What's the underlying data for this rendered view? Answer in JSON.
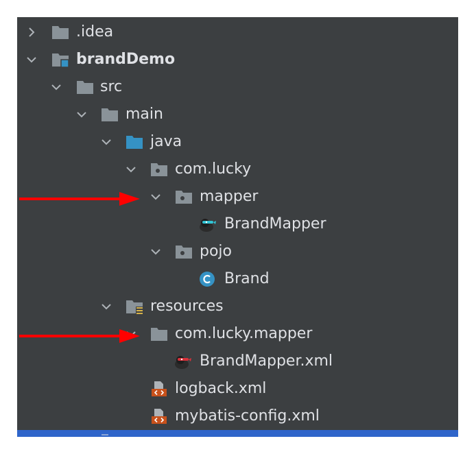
{
  "tree": {
    "rows": [
      {
        "label": "idea_folder",
        "text": ".idea"
      },
      {
        "label": "brandDemo",
        "text": "brandDemo"
      },
      {
        "label": "src",
        "text": "src"
      },
      {
        "label": "main",
        "text": "main"
      },
      {
        "label": "java",
        "text": "java"
      },
      {
        "label": "com_lucky",
        "text": "com.lucky"
      },
      {
        "label": "mapper",
        "text": "mapper"
      },
      {
        "label": "BrandMapper",
        "text": "BrandMapper"
      },
      {
        "label": "pojo",
        "text": "pojo"
      },
      {
        "label": "Brand",
        "text": "Brand"
      },
      {
        "label": "resources",
        "text": "resources"
      },
      {
        "label": "com_lucky_mapper",
        "text": "com.lucky.mapper"
      },
      {
        "label": "BrandMapper_xml",
        "text": "BrandMapper.xml"
      },
      {
        "label": "logback_xml",
        "text": "logback.xml"
      },
      {
        "label": "mybatis_config_xml",
        "text": "mybatis-config.xml"
      }
    ]
  },
  "colors": {
    "panel_bg": "#3c3f41",
    "text": "#dfe1e5",
    "folder_gray": "#8a9399",
    "source_folder_blue": "#3592c4",
    "module_marker": "#3592c4",
    "class_icon": "#3592c4",
    "xml_icon": "#c8511b",
    "annotation_arrow": "#ff0000",
    "selection_bar": "#2f65ca"
  },
  "icons": {
    "expanded": "chevron-down-icon",
    "collapsed": "chevron-right-icon",
    "folder": "folder-icon",
    "package": "package-icon",
    "module": "module-folder-icon",
    "source_root": "source-root-folder-icon",
    "resources_root": "resources-root-folder-icon",
    "mybatis_mapper": "mybatis-bird-icon",
    "java_class": "java-class-icon",
    "xml_file": "xml-file-icon"
  }
}
